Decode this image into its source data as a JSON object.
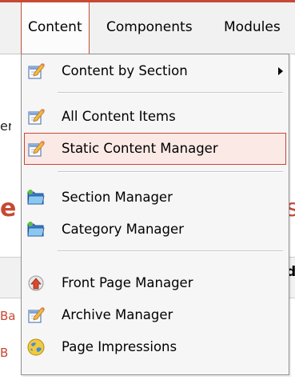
{
  "menubar": {
    "items": [
      {
        "label": "Content",
        "active": true
      },
      {
        "label": "Components"
      },
      {
        "label": "Modules"
      }
    ]
  },
  "background": {
    "left_fragment": "er",
    "heading_left": "e",
    "heading_right": "s",
    "column_header_right": "d",
    "row1_fragment": "Ba",
    "row2_fragment": "B"
  },
  "dropdown": {
    "items": [
      {
        "label": "Content by Section",
        "icon": "edit-document-icon",
        "submenu": true
      },
      {
        "label": "All Content Items",
        "icon": "edit-document-icon"
      },
      {
        "label": "Static Content Manager",
        "icon": "edit-document-icon",
        "highlighted": true
      },
      {
        "label": "Section Manager",
        "icon": "folder-icon"
      },
      {
        "label": "Category Manager",
        "icon": "folder-icon"
      },
      {
        "label": "Front Page Manager",
        "icon": "front-page-icon"
      },
      {
        "label": "Archive Manager",
        "icon": "edit-document-icon"
      },
      {
        "label": "Page Impressions",
        "icon": "globe-icon"
      }
    ]
  },
  "colors": {
    "accent": "#c64934",
    "menubar_bg": "#f1f1f1",
    "dropdown_bg": "#f6f6f6",
    "highlight_bg": "#fbe9e6"
  }
}
